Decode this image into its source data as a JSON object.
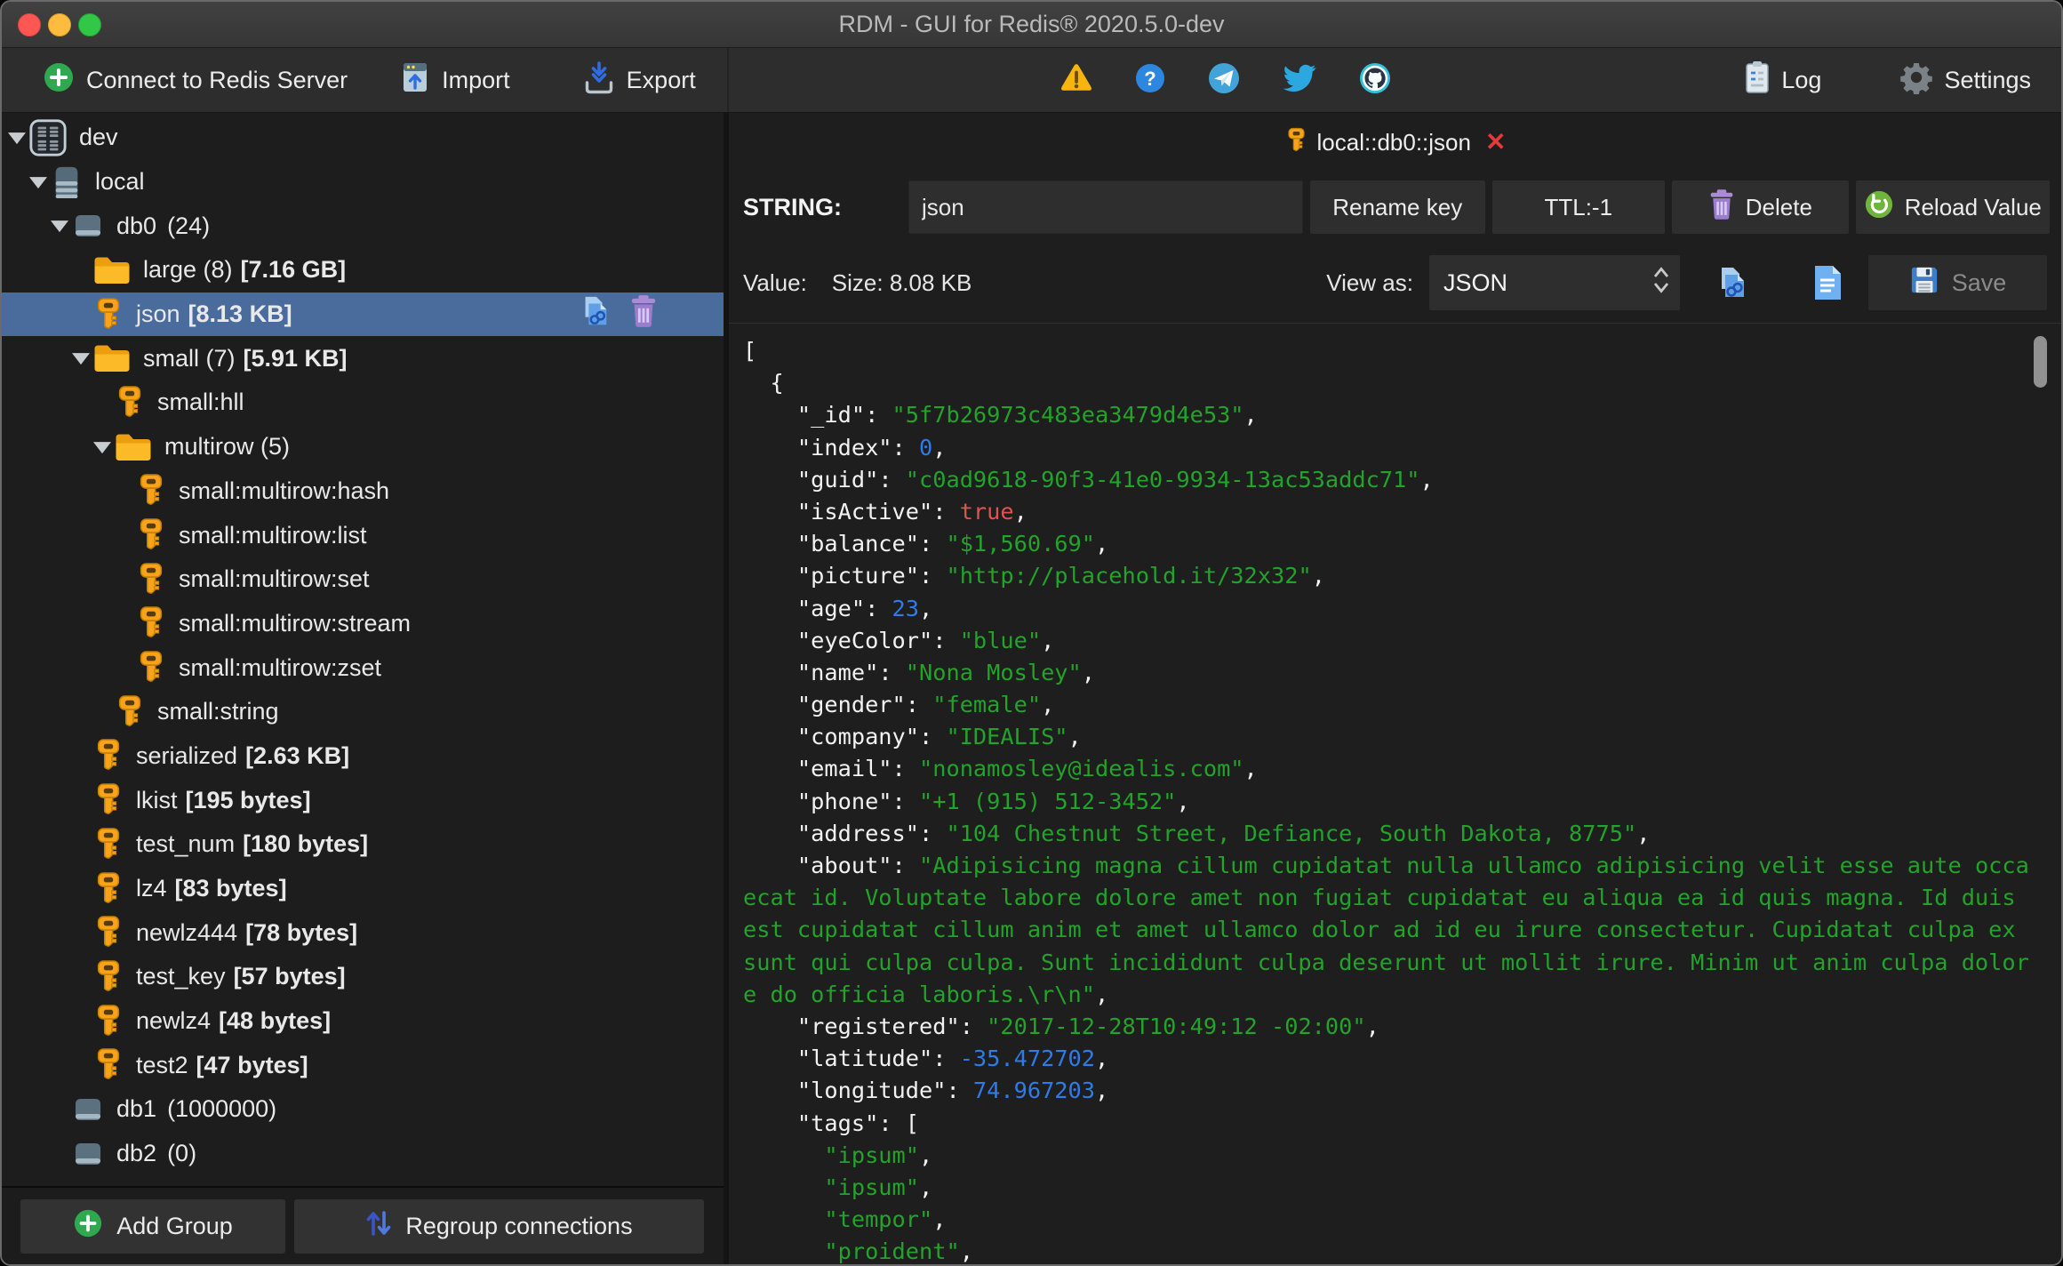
{
  "window": {
    "title": "RDM - GUI for Redis® 2020.5.0-dev"
  },
  "toolbar": {
    "connect": "Connect to Redis Server",
    "import": "Import",
    "export": "Export",
    "log": "Log",
    "settings": "Settings"
  },
  "sidebar": {
    "tree": [
      {
        "label": "dev",
        "type": "server",
        "indent": 0,
        "arrow": true
      },
      {
        "label": "local",
        "type": "database",
        "indent": 1,
        "arrow": true
      },
      {
        "label": "db0",
        "type": "db",
        "indent": 2,
        "arrow": true,
        "suffix": "(24)"
      },
      {
        "label": "large (8)",
        "type": "folder",
        "indent": 3,
        "size": "[7.16 GB]"
      },
      {
        "label": "json",
        "type": "key",
        "indent": 3,
        "size": "[8.13 KB]",
        "selected": true,
        "actions": true
      },
      {
        "label": "small (7)",
        "type": "folder",
        "indent": 3,
        "arrow": true,
        "size": "[5.91 KB]"
      },
      {
        "label": "small:hll",
        "type": "key",
        "indent": 4
      },
      {
        "label": "multirow (5)",
        "type": "folder",
        "indent": 4,
        "arrow": true
      },
      {
        "label": "small:multirow:hash",
        "type": "key",
        "indent": 5
      },
      {
        "label": "small:multirow:list",
        "type": "key",
        "indent": 5
      },
      {
        "label": "small:multirow:set",
        "type": "key",
        "indent": 5
      },
      {
        "label": "small:multirow:stream",
        "type": "key",
        "indent": 5
      },
      {
        "label": "small:multirow:zset",
        "type": "key",
        "indent": 5
      },
      {
        "label": "small:string",
        "type": "key",
        "indent": 4
      },
      {
        "label": "serialized",
        "type": "key",
        "indent": 3,
        "size": "[2.63 KB]"
      },
      {
        "label": "lkist",
        "type": "key",
        "indent": 3,
        "size": "[195 bytes]"
      },
      {
        "label": "test_num",
        "type": "key",
        "indent": 3,
        "size": "[180 bytes]"
      },
      {
        "label": "lz4",
        "type": "key",
        "indent": 3,
        "size": "[83 bytes]"
      },
      {
        "label": "newlz444",
        "type": "key",
        "indent": 3,
        "size": "[78 bytes]"
      },
      {
        "label": "test_key",
        "type": "key",
        "indent": 3,
        "size": "[57 bytes]"
      },
      {
        "label": "newlz4",
        "type": "key",
        "indent": 3,
        "size": "[48 bytes]"
      },
      {
        "label": "test2",
        "type": "key",
        "indent": 3,
        "size": "[47 bytes]"
      },
      {
        "label": "db1",
        "type": "db",
        "indent": 2,
        "suffix": "(1000000)"
      },
      {
        "label": "db2",
        "type": "db",
        "indent": 2,
        "suffix": "(0)"
      }
    ],
    "footer": {
      "add_group": "Add Group",
      "regroup": "Regroup connections"
    }
  },
  "content": {
    "tab": {
      "label": "local::db0::json",
      "close": "✕"
    },
    "key_row": {
      "type_label": "STRING:",
      "key_value": "json",
      "rename": "Rename key",
      "ttl": "TTL:-1",
      "delete": "Delete",
      "reload": "Reload Value"
    },
    "value_row": {
      "value_label": "Value:",
      "size": "Size: 8.08 KB",
      "view_as": "View as:",
      "format": "JSON",
      "save": "Save"
    }
  },
  "colors": {
    "selection": "#4a6c9d",
    "json_string": "#22a32a",
    "json_number": "#2d7cea",
    "json_bool": "#df544f",
    "key_orange": "#f9a21a",
    "accent_green": "#2fa84f",
    "close_red": "#e23b3b"
  },
  "editor": {
    "lines": [
      [
        [
          "p",
          "["
        ]
      ],
      [
        [
          "p",
          "  {"
        ]
      ],
      [
        [
          "p",
          "    "
        ],
        [
          "k",
          "\"_id\""
        ],
        [
          "p",
          ": "
        ],
        [
          "s",
          "\"5f7b26973c483ea3479d4e53\""
        ],
        [
          "p",
          ","
        ]
      ],
      [
        [
          "p",
          "    "
        ],
        [
          "k",
          "\"index\""
        ],
        [
          "p",
          ": "
        ],
        [
          "n",
          "0"
        ],
        [
          "p",
          ","
        ]
      ],
      [
        [
          "p",
          "    "
        ],
        [
          "k",
          "\"guid\""
        ],
        [
          "p",
          ": "
        ],
        [
          "s",
          "\"c0ad9618-90f3-41e0-9934-13ac53addc71\""
        ],
        [
          "p",
          ","
        ]
      ],
      [
        [
          "p",
          "    "
        ],
        [
          "k",
          "\"isActive\""
        ],
        [
          "p",
          ": "
        ],
        [
          "b",
          "true"
        ],
        [
          "p",
          ","
        ]
      ],
      [
        [
          "p",
          "    "
        ],
        [
          "k",
          "\"balance\""
        ],
        [
          "p",
          ": "
        ],
        [
          "s",
          "\"$1,560.69\""
        ],
        [
          "p",
          ","
        ]
      ],
      [
        [
          "p",
          "    "
        ],
        [
          "k",
          "\"picture\""
        ],
        [
          "p",
          ": "
        ],
        [
          "s",
          "\"http://placehold.it/32x32\""
        ],
        [
          "p",
          ","
        ]
      ],
      [
        [
          "p",
          "    "
        ],
        [
          "k",
          "\"age\""
        ],
        [
          "p",
          ": "
        ],
        [
          "n",
          "23"
        ],
        [
          "p",
          ","
        ]
      ],
      [
        [
          "p",
          "    "
        ],
        [
          "k",
          "\"eyeColor\""
        ],
        [
          "p",
          ": "
        ],
        [
          "s",
          "\"blue\""
        ],
        [
          "p",
          ","
        ]
      ],
      [
        [
          "p",
          "    "
        ],
        [
          "k",
          "\"name\""
        ],
        [
          "p",
          ": "
        ],
        [
          "s",
          "\"Nona Mosley\""
        ],
        [
          "p",
          ","
        ]
      ],
      [
        [
          "p",
          "    "
        ],
        [
          "k",
          "\"gender\""
        ],
        [
          "p",
          ": "
        ],
        [
          "s",
          "\"female\""
        ],
        [
          "p",
          ","
        ]
      ],
      [
        [
          "p",
          "    "
        ],
        [
          "k",
          "\"company\""
        ],
        [
          "p",
          ": "
        ],
        [
          "s",
          "\"IDEALIS\""
        ],
        [
          "p",
          ","
        ]
      ],
      [
        [
          "p",
          "    "
        ],
        [
          "k",
          "\"email\""
        ],
        [
          "p",
          ": "
        ],
        [
          "s",
          "\"nonamosley@idealis.com\""
        ],
        [
          "p",
          ","
        ]
      ],
      [
        [
          "p",
          "    "
        ],
        [
          "k",
          "\"phone\""
        ],
        [
          "p",
          ": "
        ],
        [
          "s",
          "\"+1 (915) 512-3452\""
        ],
        [
          "p",
          ","
        ]
      ],
      [
        [
          "p",
          "    "
        ],
        [
          "k",
          "\"address\""
        ],
        [
          "p",
          ": "
        ],
        [
          "s",
          "\"104 Chestnut Street, Defiance, South Dakota, 8775\""
        ],
        [
          "p",
          ","
        ]
      ],
      [
        [
          "p",
          "    "
        ],
        [
          "k",
          "\"about\""
        ],
        [
          "p",
          ": "
        ],
        [
          "s",
          "\"Adipisicing magna cillum cupidatat nulla ullamco adipisicing velit esse aute occa"
        ]
      ],
      [
        [
          "s",
          "ecat id. Voluptate labore dolore amet non fugiat cupidatat eu aliqua ea id quis magna. Id duis "
        ]
      ],
      [
        [
          "s",
          "est cupidatat cillum anim et amet ullamco dolor ad id eu irure consectetur. Cupidatat culpa ex "
        ]
      ],
      [
        [
          "s",
          "sunt qui culpa culpa. Sunt incididunt culpa deserunt ut mollit irure. Minim ut anim culpa dolor"
        ]
      ],
      [
        [
          "s",
          "e do officia laboris.\\r\\n\""
        ],
        [
          "p",
          ","
        ]
      ],
      [
        [
          "p",
          "    "
        ],
        [
          "k",
          "\"registered\""
        ],
        [
          "p",
          ": "
        ],
        [
          "s",
          "\"2017-12-28T10:49:12 -02:00\""
        ],
        [
          "p",
          ","
        ]
      ],
      [
        [
          "p",
          "    "
        ],
        [
          "k",
          "\"latitude\""
        ],
        [
          "p",
          ": "
        ],
        [
          "n",
          "-35.472702"
        ],
        [
          "p",
          ","
        ]
      ],
      [
        [
          "p",
          "    "
        ],
        [
          "k",
          "\"longitude\""
        ],
        [
          "p",
          ": "
        ],
        [
          "n",
          "74.967203"
        ],
        [
          "p",
          ","
        ]
      ],
      [
        [
          "p",
          "    "
        ],
        [
          "k",
          "\"tags\""
        ],
        [
          "p",
          ": "
        ],
        [
          "p",
          "["
        ]
      ],
      [
        [
          "p",
          "      "
        ],
        [
          "s",
          "\"ipsum\""
        ],
        [
          "p",
          ","
        ]
      ],
      [
        [
          "p",
          "      "
        ],
        [
          "s",
          "\"ipsum\""
        ],
        [
          "p",
          ","
        ]
      ],
      [
        [
          "p",
          "      "
        ],
        [
          "s",
          "\"tempor\""
        ],
        [
          "p",
          ","
        ]
      ],
      [
        [
          "p",
          "      "
        ],
        [
          "s",
          "\"proident\""
        ],
        [
          "p",
          ","
        ]
      ]
    ]
  }
}
